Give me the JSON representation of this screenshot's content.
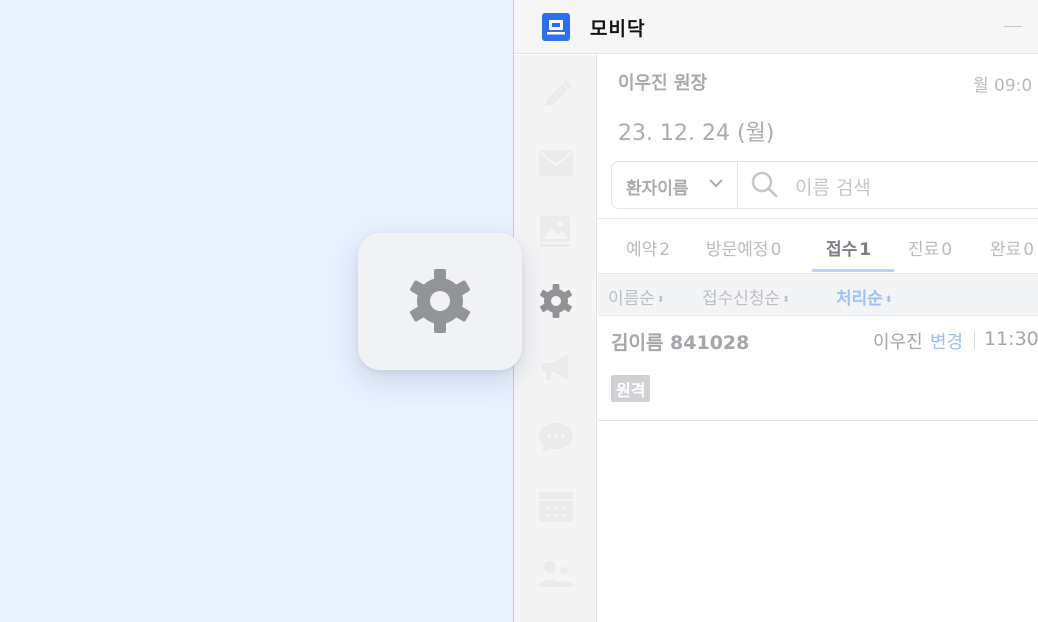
{
  "app": {
    "title": "모비닥",
    "brand_color": "#2c70ec"
  },
  "sidebar": {
    "items": [
      {
        "icon": "pencil-icon"
      },
      {
        "icon": "mail-icon"
      },
      {
        "icon": "image-icon"
      },
      {
        "icon": "gear-icon"
      },
      {
        "icon": "megaphone-icon"
      },
      {
        "icon": "chat-icon"
      },
      {
        "icon": "calendar-icon"
      },
      {
        "icon": "users-icon"
      }
    ]
  },
  "header": {
    "doctor": "이우진 원장",
    "time": "월 09:0",
    "date": "23. 12. 24 (월)"
  },
  "search": {
    "filter_label": "환자이름",
    "placeholder": "이름 검색"
  },
  "tabs": [
    {
      "label": "예약",
      "count": "2"
    },
    {
      "label": "방문예정",
      "count": "0"
    },
    {
      "label": "접수",
      "count": "1",
      "active": true
    },
    {
      "label": "진료",
      "count": "0"
    },
    {
      "label": "완료",
      "count": "0"
    }
  ],
  "sort": {
    "name": "이름순",
    "reception": "접수신청순",
    "processing": "처리순",
    "active_color": "#9ec0f5"
  },
  "patients": [
    {
      "name": "김이름 841028",
      "assignee": "이우진",
      "change": "변경",
      "time": "11:30",
      "badge": "원격"
    }
  ],
  "overlay": {
    "icon": "gear-icon"
  }
}
